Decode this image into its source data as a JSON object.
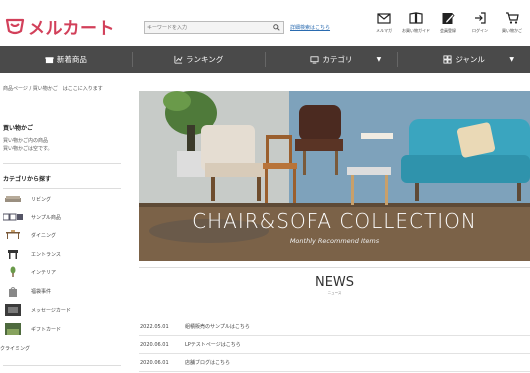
{
  "header": {
    "logo_text": "メルカート",
    "search_placeholder": "キーワードを入力",
    "advanced_search": "詳細検索はこちら",
    "icons": [
      {
        "name": "mail-icon",
        "label": "メルマガ"
      },
      {
        "name": "guide-icon",
        "label": "お買い物ガイド"
      },
      {
        "name": "register-icon",
        "label": "会員登録"
      },
      {
        "name": "login-icon",
        "label": "ログイン"
      },
      {
        "name": "cart-icon",
        "label": "買い物かご"
      }
    ]
  },
  "nav": {
    "items": [
      {
        "label": "新着商品",
        "icon": "gift-icon"
      },
      {
        "label": "ランキング",
        "icon": "ranking-icon"
      },
      {
        "label": "カテゴリ",
        "icon": "monitor-icon",
        "dropdown": true
      },
      {
        "label": "ジャンル",
        "icon": "genre-icon",
        "dropdown": true
      }
    ]
  },
  "sidebar": {
    "breadcrumb": "商品ページ / 買い物かご　はここに入ります",
    "cart_heading": "買い物かご",
    "cart_text_1": "買い物かご内の商品",
    "cart_text_2": "買い物かごは空です。",
    "category_heading": "カテゴリから探す",
    "categories": [
      {
        "label": "リビング"
      },
      {
        "label": "サンプル商品"
      },
      {
        "label": "ダイニング"
      },
      {
        "label": "エントランス"
      },
      {
        "label": "インテリア"
      },
      {
        "label": "福袋事件"
      },
      {
        "label": "メッセージカード"
      },
      {
        "label": "ギフトカード"
      },
      {
        "label": "クライミング"
      }
    ]
  },
  "hero": {
    "title": "CHAIR&SOFA COLLECTION",
    "subtitle": "Monthly Recommend Items"
  },
  "news": {
    "title": "NEWS",
    "subtitle": "ニュース",
    "items": [
      {
        "date": "2022.05.01",
        "text": "組積販売のサンプルはこちら"
      },
      {
        "date": "2020.06.01",
        "text": "LPテストページはこちら"
      },
      {
        "date": "2020.06.01",
        "text": "店舗ブログはこちら"
      }
    ]
  },
  "colors": {
    "brand": "#d2405a",
    "nav_bg": "#4a4a4a",
    "link": "#2a6bb0"
  }
}
